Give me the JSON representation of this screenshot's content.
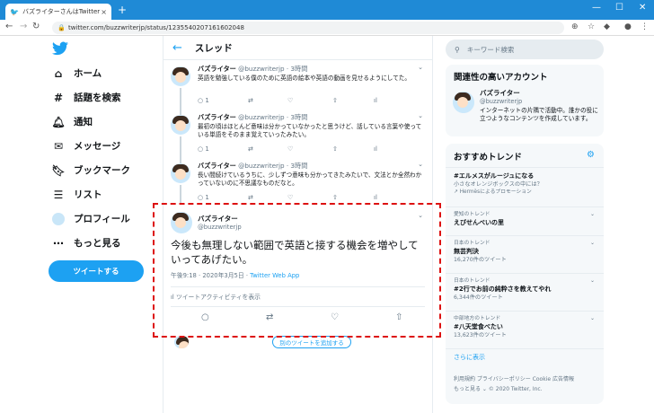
{
  "browser": {
    "tab_title": "バズライターさんはTwitterを使ってい",
    "tab_close": "×",
    "new_tab": "+",
    "url": "twitter.com/buzzwriterjp/status/1235540207161602048"
  },
  "sidebar": {
    "items": [
      {
        "label": "ホーム",
        "icon": "home-icon"
      },
      {
        "label": "話題を検索",
        "icon": "hashtag-icon"
      },
      {
        "label": "通知",
        "icon": "bell-icon"
      },
      {
        "label": "メッセージ",
        "icon": "mail-icon"
      },
      {
        "label": "ブックマーク",
        "icon": "bookmark-icon"
      },
      {
        "label": "リスト",
        "icon": "list-icon"
      },
      {
        "label": "プロフィール",
        "icon": "avatar"
      },
      {
        "label": "もっと見る",
        "icon": "more-icon"
      }
    ],
    "tweet_button": "ツイートする"
  },
  "thread": {
    "title": "スレッド",
    "tweets": [
      {
        "name": "バズライター",
        "handle": "@buzzwriterjp · 3時間",
        "text": "英語を勉強している僕のために英語の絵本や英語の動画を見せるようにしてた。",
        "reply_count": "1"
      },
      {
        "name": "バズライター",
        "handle": "@buzzwriterjp · 3時間",
        "text": "最初の頃はほとんど意味は分かっていなかったと思うけど、話している言葉や使っている単語をそのまま覚えていったみたい。",
        "reply_count": "1"
      },
      {
        "name": "バズライター",
        "handle": "@buzzwriterjp · 3時間",
        "text": "長い間続けているうちに、少しずつ意味も分かってきたみたいで、文法とか全然わかっていないのに不思議なものだなと。",
        "reply_count": "1"
      }
    ],
    "focus": {
      "name": "バズライター",
      "handle": "@buzzwriterjp",
      "text": "今後も無理しない範囲で英語と接する機会を増やしていってあげたい。",
      "time": "午後9:18 · 2020年3月5日 · ",
      "via": "Twitter Web App",
      "activity": "ツイートアクティビティを表示"
    },
    "add_another": "別のツイートを追加する"
  },
  "right": {
    "search_placeholder": "キーワード検索",
    "relevant": {
      "title": "関連性の高いアカウント",
      "name": "バズライター",
      "handle": "@buzzwriterjp",
      "desc": "インターネットの片隅で活動中。誰かの役に立つようなコンテンツを作成しています。"
    },
    "trends": {
      "title": "おすすめトレンド",
      "promoted": {
        "name": "#エルメスがルージュになる",
        "sub": "小さなオレンジボックスの中には？",
        "ctx": "Hermèsによるプロモーション"
      },
      "items": [
        {
          "ctx": "愛知のトレンド",
          "name": "えびせんべいの里",
          "sub": ""
        },
        {
          "ctx": "日本のトレンド",
          "name": "無芸判決",
          "sub": "16,270件のツイート"
        },
        {
          "ctx": "日本のトレンド",
          "name": "#2行でお前の純粋さを教えてやれ",
          "sub": "6,344件のツイート"
        },
        {
          "ctx": "中部地方のトレンド",
          "name": "#八天堂食べたい",
          "sub": "13,623件のツイート"
        }
      ],
      "show_more": "さらに表示"
    },
    "footer": {
      "line1": "利用規約  プライバシーポリシー  Cookie  広告情報",
      "line2": "もっと見る ⌄  © 2020 Twitter, Inc."
    }
  },
  "colors": {
    "accent": "#1da1f2",
    "chrome": "#1f8ad6",
    "highlight": "#dd1111"
  }
}
